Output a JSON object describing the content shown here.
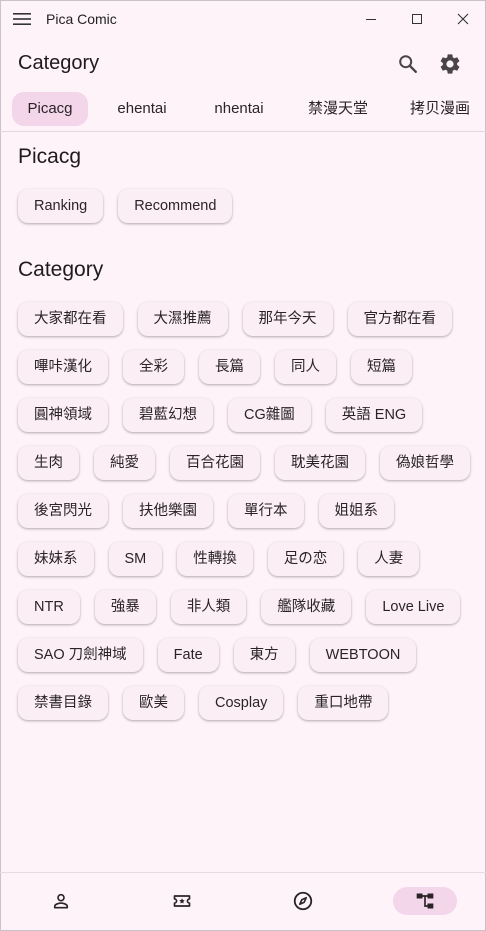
{
  "window": {
    "title": "Pica Comic"
  },
  "appbar": {
    "title": "Category"
  },
  "tabs": [
    {
      "label": "Picacg",
      "active": true
    },
    {
      "label": "ehentai",
      "active": false
    },
    {
      "label": "nhentai",
      "active": false
    },
    {
      "label": "禁漫天堂",
      "active": false
    },
    {
      "label": "拷贝漫画",
      "active": false
    }
  ],
  "picacg_section": {
    "title": "Picacg",
    "chips": [
      "Ranking",
      "Recommend"
    ]
  },
  "category_section": {
    "title": "Category",
    "chips": [
      "大家都在看",
      "大濕推薦",
      "那年今天",
      "官方都在看",
      "嗶咔漢化",
      "全彩",
      "長篇",
      "同人",
      "短篇",
      "圓神領域",
      "碧藍幻想",
      "CG雜圖",
      "英語 ENG",
      "生肉",
      "純愛",
      "百合花園",
      "耽美花園",
      "偽娘哲學",
      "後宮閃光",
      "扶他樂園",
      "單行本",
      "姐姐系",
      "妹妹系",
      "SM",
      "性轉換",
      "足の恋",
      "人妻",
      "NTR",
      "強暴",
      "非人類",
      "艦隊收藏",
      "Love Live",
      "SAO 刀劍神域",
      "Fate",
      "東方",
      "WEBTOON",
      "禁書目錄",
      "歐美",
      "Cosplay",
      "重口地帶"
    ]
  },
  "bottom_nav": [
    {
      "icon": "person-icon",
      "active": false
    },
    {
      "icon": "ticket-icon",
      "active": false
    },
    {
      "icon": "compass-icon",
      "active": false
    },
    {
      "icon": "category-tree-icon",
      "active": true
    }
  ],
  "colors": {
    "accent": "#f3d6ea",
    "background": "#fdf3f8",
    "chip": "#fbeef5"
  }
}
